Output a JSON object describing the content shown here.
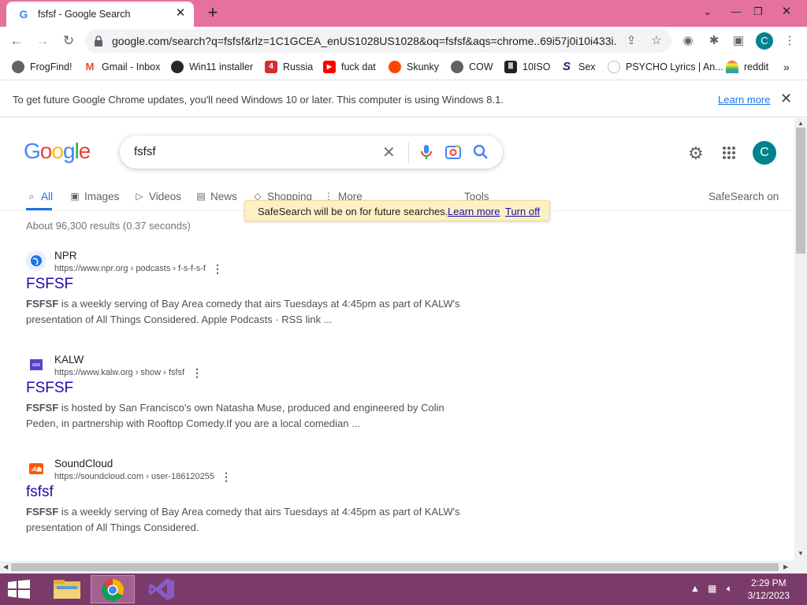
{
  "browser": {
    "tab_title": "fsfsf - Google Search",
    "url": "google.com/search?q=fsfsf&rlz=1C1GCEA_enUS1028US1028&oq=fsfsf&aqs=chrome..69i57j0i10i433i...",
    "profile_initial": "C"
  },
  "bookmarks": [
    {
      "label": "FrogFind!",
      "icon": "globe-icon"
    },
    {
      "label": "Gmail - Inbox",
      "icon": "gmail-icon"
    },
    {
      "label": "Win11 installer",
      "icon": "github-icon"
    },
    {
      "label": "Russia",
      "icon": "red-square-icon"
    },
    {
      "label": "fuck dat",
      "icon": "youtube-icon"
    },
    {
      "label": "Skunky",
      "icon": "reddit-icon"
    },
    {
      "label": "COW",
      "icon": "globe-icon"
    },
    {
      "label": "10ISO",
      "icon": "building-icon"
    },
    {
      "label": "Sex",
      "icon": "s-icon"
    },
    {
      "label": "PSYCHO Lyrics | An...",
      "icon": "circle-icon"
    },
    {
      "label": "reddit",
      "icon": "rainbow-icon"
    }
  ],
  "infobar": {
    "message": "To get future Google Chrome updates, you'll need Windows 10 or later. This computer is using Windows 8.1.",
    "learn_more": "Learn more"
  },
  "search": {
    "query": "fsfsf",
    "tabs": [
      "All",
      "Images",
      "Videos",
      "News",
      "Shopping",
      "More"
    ],
    "tools": "Tools",
    "safesearch": "SafeSearch on",
    "stats": "About 96,300 results (0.37 seconds)",
    "account_initial": "C"
  },
  "tooltip": {
    "message": "SafeSearch will be on for future searches.",
    "learn_more": "Learn more",
    "turn_off": "Turn off"
  },
  "results": [
    {
      "site": "NPR",
      "cite": "https://www.npr.org › podcasts › f-s-f-s-f",
      "title": "FSFSF",
      "snippet_bold": "FSFSF",
      "snippet": " is a weekly serving of Bay Area comedy that airs Tuesdays at 4:45pm as part of KALW's presentation of All Things Considered. Apple Podcasts · RSS link ..."
    },
    {
      "site": "KALW",
      "cite": "https://www.kalw.org › show › fsfsf",
      "title": "FSFSF",
      "snippet_bold": "FSFSF",
      "snippet": " is hosted by San Francisco's own Natasha Muse, produced and engineered by Colin Peden, in partnership with Rooftop Comedy.If you are a local comedian ..."
    },
    {
      "site": "SoundCloud",
      "cite": "https://soundcloud.com › user-186120255",
      "title": "fsfsf",
      "snippet_bold": "FSFSF",
      "snippet": " is a weekly serving of Bay Area comedy that airs Tuesdays at 4:45pm as part of KALW's presentation of All Things Considered."
    }
  ],
  "taskbar": {
    "time": "2:29 PM",
    "date": "3/12/2023"
  },
  "colors": {
    "titlebar": "#e5729c",
    "taskbar": "#7b3b6a",
    "link": "#1a0dab",
    "accent": "#1a73e8"
  }
}
